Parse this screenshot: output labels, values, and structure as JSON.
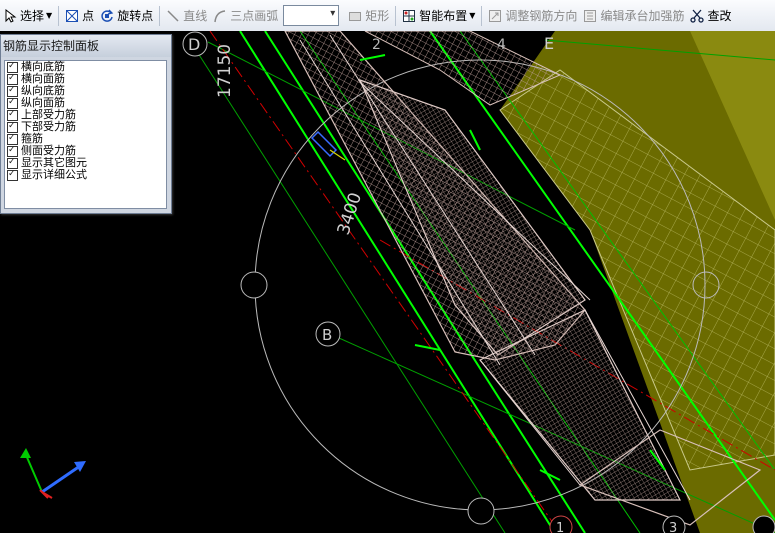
{
  "toolbar": {
    "select": "选择",
    "point": "点",
    "rotate_point": "旋转点",
    "line": "直线",
    "arc": "三点画弧",
    "rect": "矩形",
    "smart_layout": "智能布置",
    "adjust_dir": "调整钢筋方向",
    "edit_cap": "编辑承台加强筋",
    "query_cut": "查改"
  },
  "panel": {
    "title": "钢筋显示控制面板",
    "options": [
      "横向底筋",
      "横向面筋",
      "纵向底筋",
      "纵向面筋",
      "上部受力筋",
      "下部受力筋",
      "箍筋",
      "侧面受力筋",
      "显示其它图元",
      "显示详细公式"
    ]
  },
  "canvas": {
    "axis_d": "D",
    "axis_e": "E",
    "axis_b": "B",
    "axis_1": "1",
    "axis_2": "2",
    "axis_3": "3",
    "axis_4": "4",
    "dim_17150": "17150",
    "dim_3400": "3400",
    "colors": {
      "background": "#000000",
      "grid_green": "#00c800",
      "wall_green": "#00ff00",
      "slab_olive": "#6e6e00",
      "rebar_pink": "#c8a8a0",
      "axis_circle": "#bbbbbb"
    }
  }
}
